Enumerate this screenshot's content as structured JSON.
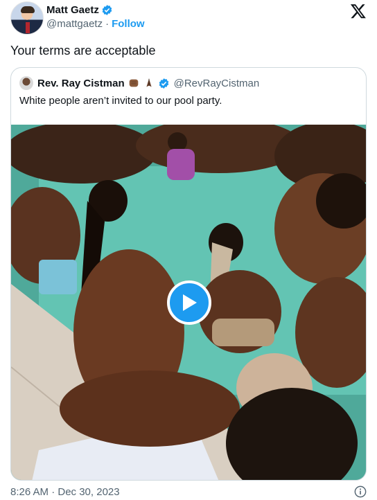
{
  "author": {
    "name": "Matt Gaetz",
    "handle": "@mattgaetz",
    "separator": "·",
    "follow_label": "Follow",
    "verified_icon": "verified-badge-icon"
  },
  "tweet": {
    "text": "Your terms are acceptable",
    "timestamp": "8:26 AM · Dec 30, 2023"
  },
  "quoted": {
    "name": "Rev. Ray Cistman",
    "handle": "@RevRayCistman",
    "text": "White people aren’t invited to our pool party.",
    "emojis": [
      "raised-fist-emoji",
      "folded-hands-emoji"
    ]
  },
  "media": {
    "type": "video",
    "play_icon": "play-icon"
  },
  "colors": {
    "accent": "#1d9bf0",
    "secondary_text": "#536471",
    "border": "#cfd9de"
  }
}
